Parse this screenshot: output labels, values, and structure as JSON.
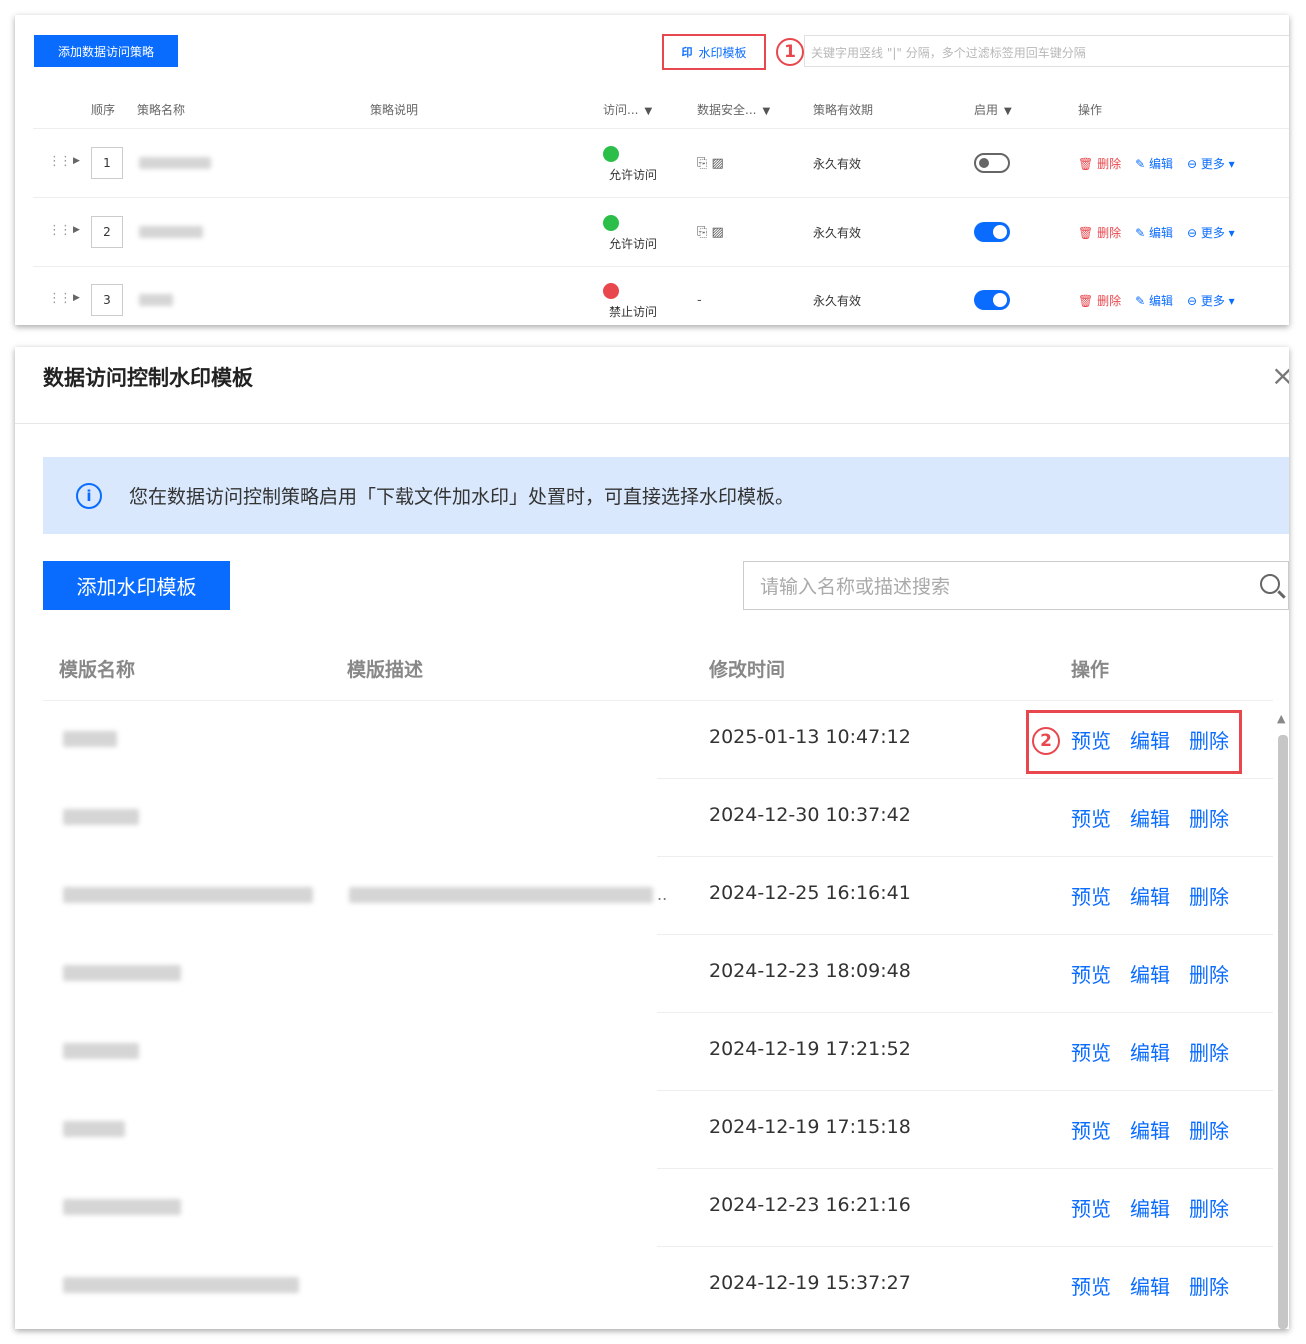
{
  "top": {
    "add_policy": "添加数据访问策略",
    "watermark_button": "水印模板",
    "watermark_icon_glyph": "印",
    "badge1": "1",
    "filter_placeholder": "关键字用竖线 \"|\" 分隔，多个过滤标签用回车键分隔",
    "columns": {
      "order": "顺序",
      "name": "策略名称",
      "desc": "策略说明",
      "access": "访问...",
      "security": "数据安全...",
      "validity": "策略有效期",
      "enabled": "启用",
      "ops": "操作"
    },
    "rows": [
      {
        "seq": "1",
        "access": "允许访问",
        "security": "⎘ ▨",
        "validity": "永久有效",
        "enabled": false
      },
      {
        "seq": "2",
        "access": "允许访问",
        "security": "⎘ ▨",
        "validity": "永久有效",
        "enabled": true
      },
      {
        "seq": "3",
        "access": "禁止访问",
        "security": "-",
        "validity": "永久有效",
        "enabled": true
      }
    ],
    "op_delete": "删除",
    "op_edit": "编辑",
    "op_more": "更多",
    "colors": {
      "primary": "#0a6cff",
      "danger": "#e8474d",
      "allow": "#2bbf4a",
      "deny": "#e8474d"
    }
  },
  "dialog": {
    "title": "数据访问控制水印模板",
    "close": "×",
    "info": "您在数据访问控制策略启用「下载文件加水印」处置时，可直接选择水印模板。",
    "add_template": "添加水印模板",
    "search_placeholder": "请输入名称或描述搜索",
    "columns": {
      "name": "模版名称",
      "desc": "模版描述",
      "time": "修改时间",
      "ops": "操作"
    },
    "badge2": "2",
    "op_preview": "预览",
    "op_edit": "编辑",
    "op_delete": "删除",
    "rows": [
      {
        "time": "2025-01-13 10:47:12"
      },
      {
        "time": "2024-12-30 10:37:42"
      },
      {
        "time": "2024-12-25 16:16:41"
      },
      {
        "time": "2024-12-23 18:09:48"
      },
      {
        "time": "2024-12-19 17:21:52"
      },
      {
        "time": "2024-12-19 17:15:18"
      },
      {
        "time": "2024-12-23 16:21:16"
      },
      {
        "time": "2024-12-19 15:37:27"
      }
    ]
  }
}
